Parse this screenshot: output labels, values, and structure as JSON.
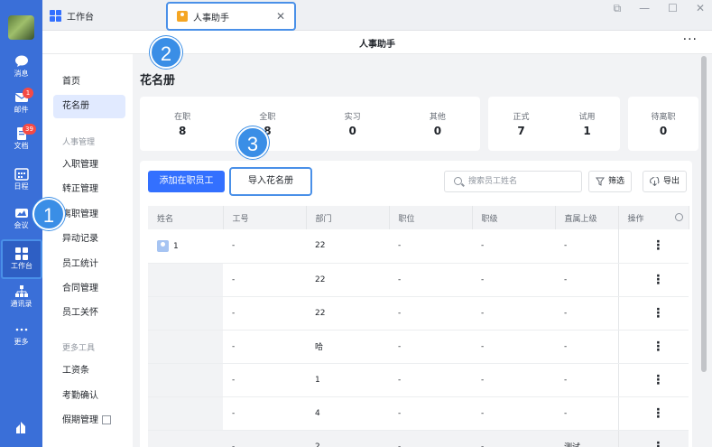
{
  "rail": {
    "items": [
      {
        "label": "消息",
        "icon": "chat-bubble-icon"
      },
      {
        "label": "邮件",
        "icon": "mail-icon",
        "badge": "1"
      },
      {
        "label": "文档",
        "icon": "document-icon",
        "badge": "39"
      },
      {
        "label": "日程",
        "icon": "calendar-icon"
      },
      {
        "label": "会议",
        "icon": "video-icon"
      },
      {
        "label": "工作台",
        "icon": "workbench-grid-icon"
      },
      {
        "label": "通讯录",
        "icon": "contacts-tree-icon"
      },
      {
        "label": "更多",
        "icon": "more-dots-icon"
      }
    ]
  },
  "titlebar": {
    "app_tab": "工作台",
    "doc_tab": "人事助手",
    "close_glyph": "✕",
    "window_controls": [
      "⧉",
      "—",
      "☐",
      "✕"
    ]
  },
  "page": {
    "title": "人事助手",
    "more": "···"
  },
  "sidenav": {
    "items": [
      {
        "label": "首页"
      },
      {
        "label": "花名册",
        "active": true
      }
    ],
    "group1": "人事管理",
    "group1_items": [
      "入职管理",
      "转正管理",
      "离职管理",
      "异动记录",
      "员工统计",
      "合同管理",
      "员工关怀"
    ],
    "group2": "更多工具",
    "group2_items": [
      "工资条",
      "考勤确认",
      "假期管理"
    ]
  },
  "main": {
    "title": "花名册",
    "stats_group1": [
      {
        "label": "在职",
        "value": "8"
      },
      {
        "label": "全职",
        "value": "8"
      },
      {
        "label": "实习",
        "value": "0"
      },
      {
        "label": "其他",
        "value": "0"
      }
    ],
    "stats_group2": [
      {
        "label": "正式",
        "value": "7"
      },
      {
        "label": "试用",
        "value": "1"
      }
    ],
    "stats_group3": [
      {
        "label": "待离职",
        "value": "0"
      }
    ],
    "buttons": {
      "add": "添加在职员工",
      "import": "导入花名册",
      "filter": "筛选",
      "export": "导出"
    },
    "search_placeholder": "搜索员工姓名",
    "table": {
      "headers": [
        "姓名",
        "工号",
        "部门",
        "职位",
        "职级",
        "直属上级",
        "操作"
      ],
      "rows": [
        [
          "1",
          "-",
          "22",
          "-",
          "-",
          "-"
        ],
        [
          "",
          "-",
          "22",
          "-",
          "-",
          "-"
        ],
        [
          "",
          "-",
          "22",
          "-",
          "-",
          "-"
        ],
        [
          "",
          "-",
          "哈",
          "-",
          "-",
          "-"
        ],
        [
          "",
          "-",
          "1",
          "-",
          "-",
          "-"
        ],
        [
          "",
          "-",
          "4",
          "-",
          "-",
          "-"
        ],
        [
          "",
          "-",
          "2",
          "-",
          "-",
          "测试"
        ]
      ],
      "op_glyph": "⋮"
    }
  },
  "callouts": [
    "1",
    "2",
    "3"
  ]
}
